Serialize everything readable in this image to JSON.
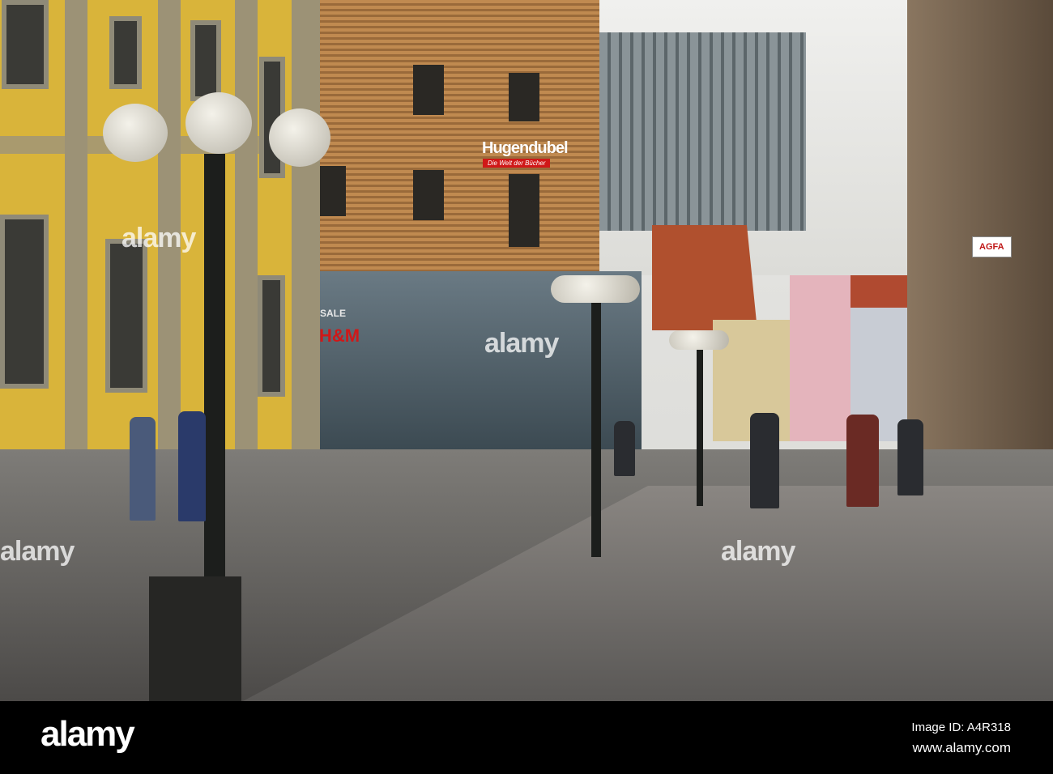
{
  "photo": {
    "signs": {
      "store_name": "Hugendubel",
      "store_tagline": "Die Welt der Bücher",
      "shop_sale": "SALE",
      "shop_brand": "H&M",
      "agfa": "AGFA"
    },
    "watermark": "alamy"
  },
  "footer": {
    "logo": "alamy",
    "image_id": "Image ID: A4R318",
    "url": "www.alamy.com"
  }
}
